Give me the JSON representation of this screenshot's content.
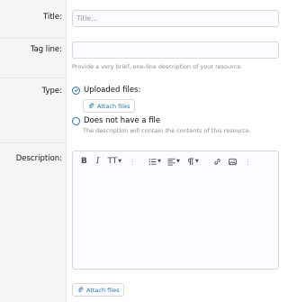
{
  "title_field": {
    "label": "Title:",
    "placeholder": "Title..."
  },
  "tagline_field": {
    "label": "Tag line:",
    "hint": "Provide a very brief, one-line description of your resource."
  },
  "type_field": {
    "label": "Type:",
    "option_uploaded": "Uploaded files:",
    "attach_label": "Attach files",
    "option_no_file": "Does not have a file",
    "no_file_hint": "The description will contain the contents of this resource."
  },
  "description_field": {
    "label": "Description:",
    "toolbar_bold": "B",
    "toolbar_italic": "I",
    "toolbar_textsize": "TT",
    "toolbar_more": "⋮",
    "attach_label": "Attach files"
  },
  "colors": {
    "accent": "#2577b1",
    "sidebar_bg": "#f5f5f5",
    "border": "#d8d8d8"
  }
}
